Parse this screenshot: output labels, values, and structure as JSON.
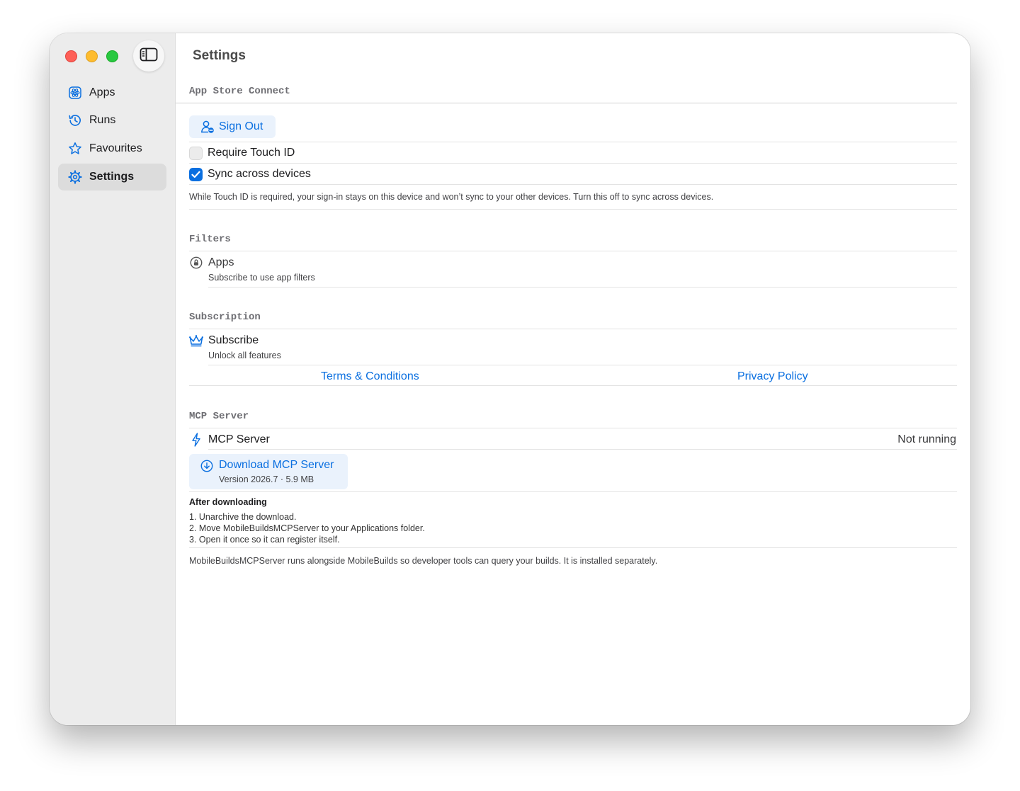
{
  "sidebar": {
    "items": [
      {
        "label": "Apps",
        "icon": "atom-icon",
        "active": false
      },
      {
        "label": "Runs",
        "icon": "history-icon",
        "active": false
      },
      {
        "label": "Favourites",
        "icon": "star-icon",
        "active": false
      },
      {
        "label": "Settings",
        "icon": "gear-icon",
        "active": true
      }
    ]
  },
  "page": {
    "title": "Settings"
  },
  "app_store_connect": {
    "header": "App Store Connect",
    "sign_out_label": "Sign Out",
    "require_touch_id": {
      "label": "Require Touch ID",
      "checked": false
    },
    "sync_across_devices": {
      "label": "Sync across devices",
      "checked": true
    },
    "note": "While Touch ID is required, your sign-in stays on this device and won’t sync to your other devices. Turn this off to sync across devices."
  },
  "filters": {
    "header": "Filters",
    "apps_label": "Apps",
    "apps_caption": "Subscribe to use app filters"
  },
  "subscription": {
    "header": "Subscription",
    "subscribe_label": "Subscribe",
    "subscribe_caption": "Unlock all features",
    "terms_label": "Terms & Conditions",
    "privacy_label": "Privacy Policy"
  },
  "mcp": {
    "header": "MCP Server",
    "server_label": "MCP Server",
    "status": "Not running",
    "download_label": "Download MCP Server",
    "download_caption": "Version 2026.7 · 5.9 MB",
    "after_heading": "After downloading",
    "steps": [
      "1. Unarchive the download.",
      "2. Move MobileBuildsMCPServer to your Applications folder.",
      "3. Open it once so it can register itself."
    ],
    "footer": "MobileBuildsMCPServer runs alongside MobileBuilds so developer tools can query your builds. It is installed separately."
  },
  "colors": {
    "accent": "#0a6fe0",
    "sidebar_bg": "#ececec",
    "selection_bg": "#dcdcdc"
  }
}
